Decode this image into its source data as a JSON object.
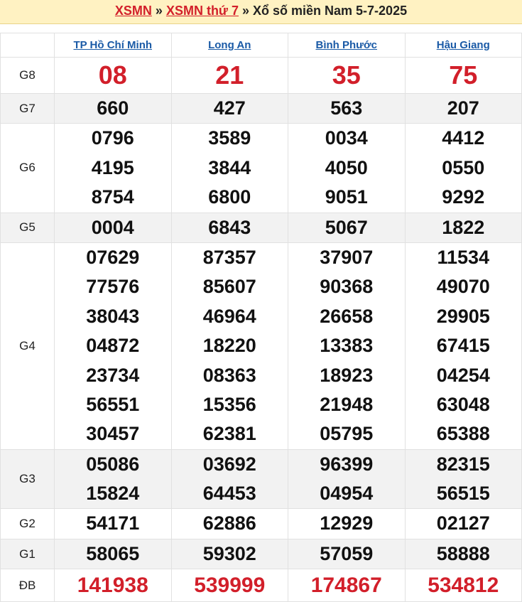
{
  "header": {
    "link1": "XSMN",
    "sep1": " » ",
    "link2": "XSMN thứ 7",
    "sep2": " » ",
    "title": "Xổ số miền Nam 5-7-2025"
  },
  "provinces": [
    "TP Hồ Chí Minh",
    "Long An",
    "Bình Phước",
    "Hậu Giang"
  ],
  "prizes": [
    {
      "label": "G8",
      "results": [
        [
          "08"
        ],
        [
          "21"
        ],
        [
          "35"
        ],
        [
          "75"
        ]
      ]
    },
    {
      "label": "G7",
      "results": [
        [
          "660"
        ],
        [
          "427"
        ],
        [
          "563"
        ],
        [
          "207"
        ]
      ]
    },
    {
      "label": "G6",
      "results": [
        [
          "0796",
          "4195",
          "8754"
        ],
        [
          "3589",
          "3844",
          "6800"
        ],
        [
          "0034",
          "4050",
          "9051"
        ],
        [
          "4412",
          "0550",
          "9292"
        ]
      ]
    },
    {
      "label": "G5",
      "results": [
        [
          "0004"
        ],
        [
          "6843"
        ],
        [
          "5067"
        ],
        [
          "1822"
        ]
      ]
    },
    {
      "label": "G4",
      "results": [
        [
          "07629",
          "77576",
          "38043",
          "04872",
          "23734",
          "56551",
          "30457"
        ],
        [
          "87357",
          "85607",
          "46964",
          "18220",
          "08363",
          "15356",
          "62381"
        ],
        [
          "37907",
          "90368",
          "26658",
          "13383",
          "18923",
          "21948",
          "05795"
        ],
        [
          "11534",
          "49070",
          "29905",
          "67415",
          "04254",
          "63048",
          "65388"
        ]
      ]
    },
    {
      "label": "G3",
      "results": [
        [
          "05086",
          "15824"
        ],
        [
          "03692",
          "64453"
        ],
        [
          "96399",
          "04954"
        ],
        [
          "82315",
          "56515"
        ]
      ]
    },
    {
      "label": "G2",
      "results": [
        [
          "54171"
        ],
        [
          "62886"
        ],
        [
          "12929"
        ],
        [
          "02127"
        ]
      ]
    },
    {
      "label": "G1",
      "results": [
        [
          "58065"
        ],
        [
          "59302"
        ],
        [
          "57059"
        ],
        [
          "58888"
        ]
      ]
    },
    {
      "label": "ĐB",
      "results": [
        [
          "141938"
        ],
        [
          "539999"
        ],
        [
          "174867"
        ],
        [
          "534812"
        ]
      ]
    }
  ]
}
